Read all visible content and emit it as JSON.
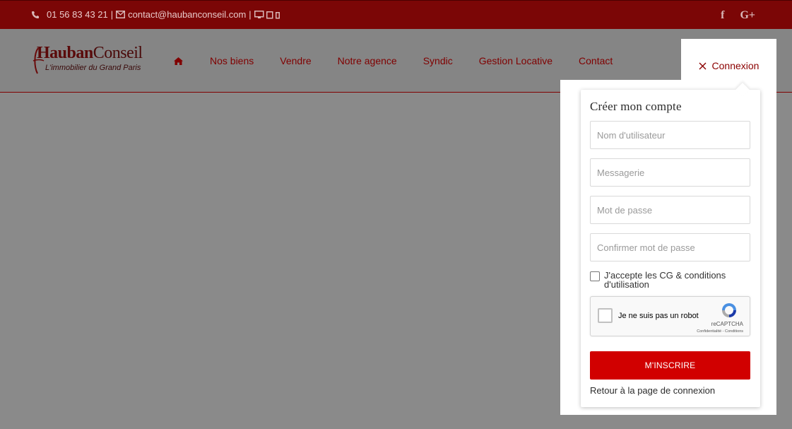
{
  "topbar": {
    "phone": "01 56 83 43 21",
    "separator1": "|",
    "email": "contact@haubanconseil.com",
    "separator2": "|",
    "social": {
      "facebook": "f",
      "googleplus": "G+"
    }
  },
  "logo": {
    "title_part1": "Hauban",
    "title_part2": "Conseil",
    "tagline": "L'immobilier du Grand Paris"
  },
  "nav": {
    "items": [
      {
        "label": "Nos biens"
      },
      {
        "label": "Vendre"
      },
      {
        "label": "Notre agence"
      },
      {
        "label": "Syndic"
      },
      {
        "label": "Gestion Locative"
      },
      {
        "label": "Contact"
      }
    ],
    "connexion_label": "Connexion"
  },
  "register": {
    "title": "Créer mon compte",
    "username_placeholder": "Nom d'utilisateur",
    "email_placeholder": "Messagerie",
    "password_placeholder": "Mot de passe",
    "confirm_placeholder": "Confirmer mot de passe",
    "terms_label": "J'accepte les CG & conditions d'utilisation",
    "recaptcha": {
      "label": "Je ne suis pas un robot",
      "brand": "reCAPTCHA",
      "links": "Confidentialité - Conditions"
    },
    "submit_label": "M'INSCRIRE",
    "back_label": "Retour à la page de connexion"
  },
  "colors": {
    "brand_dark": "#7b0606",
    "brand_red": "#d10000",
    "overlay_gray": "#8a8a8a"
  }
}
